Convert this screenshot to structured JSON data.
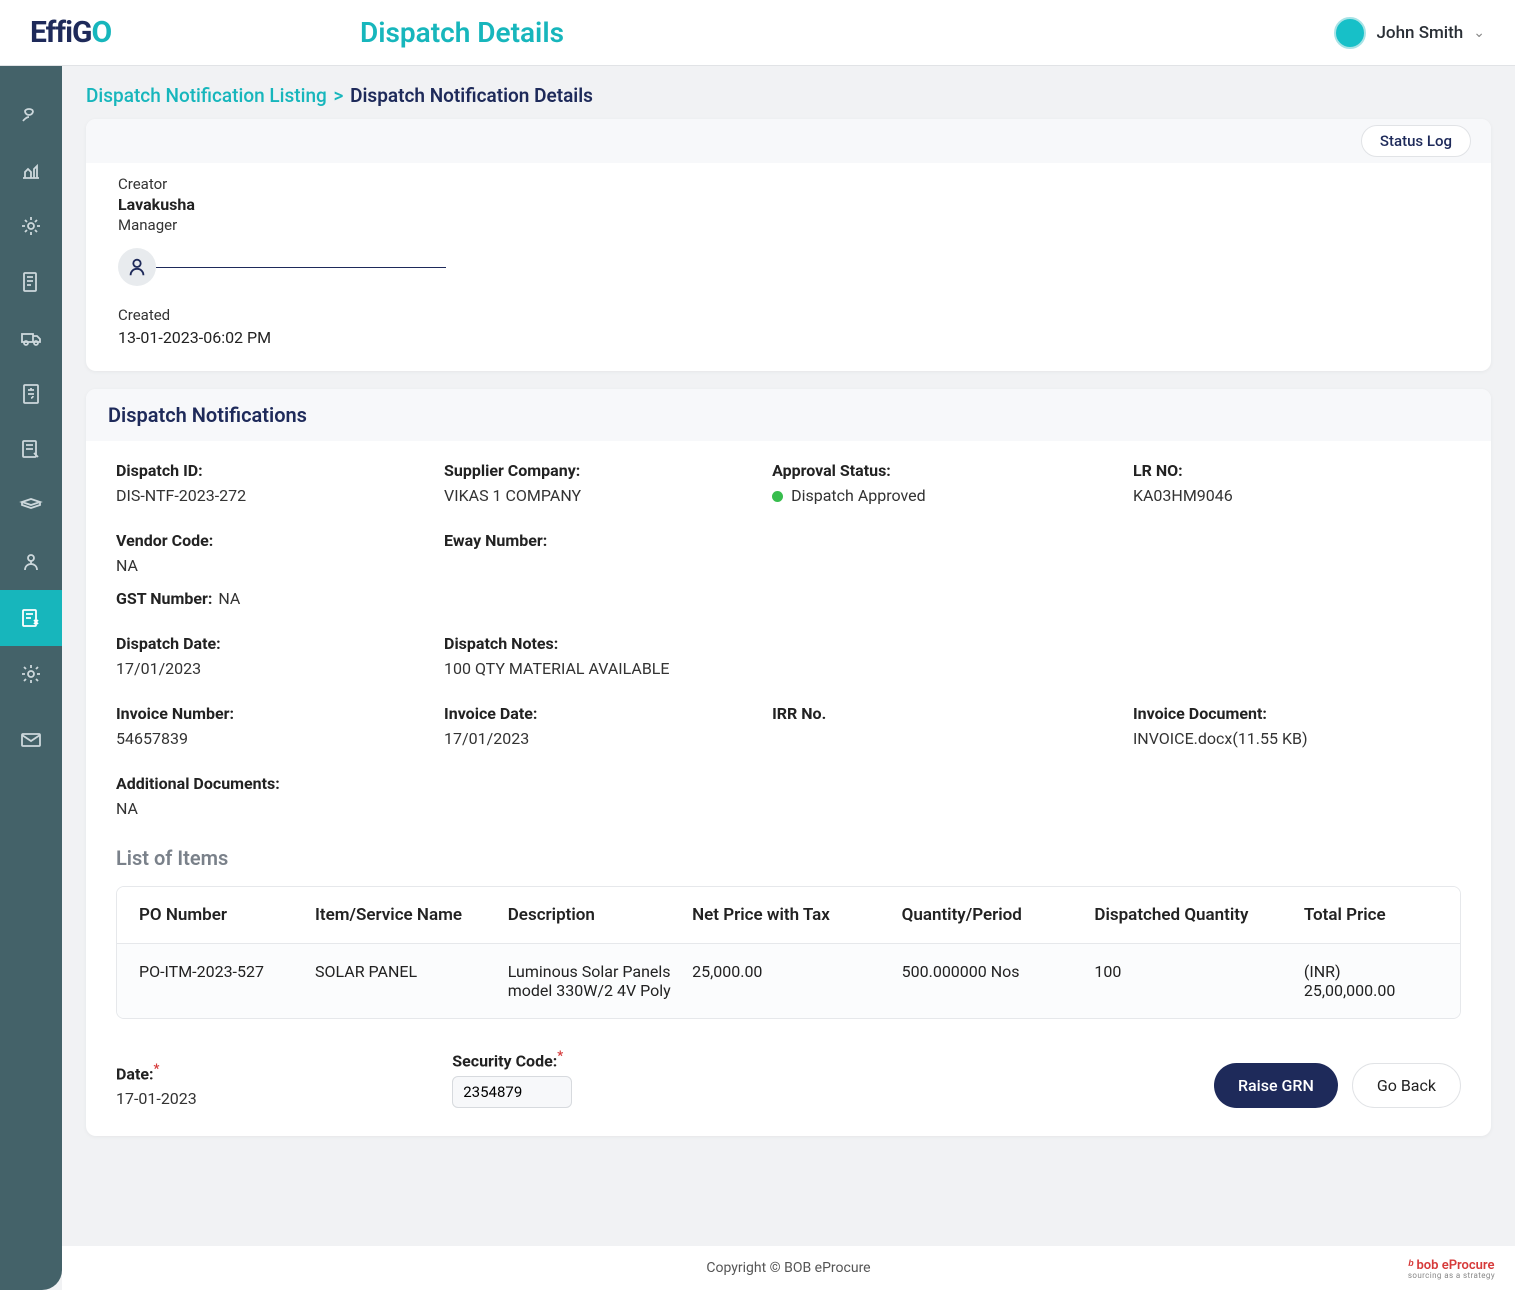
{
  "header": {
    "logo_a": "Effi",
    "logo_b": "G",
    "logo_c": "O",
    "page_title": "Dispatch Details",
    "user_name": "John Smith"
  },
  "breadcrumb": {
    "parent": "Dispatch Notification Listing",
    "sep": ">",
    "current": "Dispatch Notification Details"
  },
  "creator": {
    "status_log_btn": "Status Log",
    "label": "Creator",
    "name": "Lavakusha",
    "role": "Manager",
    "status": "Created",
    "datetime": "13-01-2023-06:02 PM"
  },
  "dispatch": {
    "section_title": "Dispatch Notifications",
    "dispatch_id_label": "Dispatch ID:",
    "dispatch_id": "DIS-NTF-2023-272",
    "supplier_label": "Supplier Company:",
    "supplier": "VIKAS 1 COMPANY",
    "approval_label": "Approval Status:",
    "approval": "Dispatch Approved",
    "lr_label": "LR NO:",
    "lr": "KA03HM9046",
    "vendor_label": "Vendor Code:",
    "vendor": "NA",
    "eway_label": "Eway Number:",
    "eway": "",
    "gst_label": "GST Number:",
    "gst": "NA",
    "date_label": "Dispatch Date:",
    "date": "17/01/2023",
    "notes_label": "Dispatch Notes:",
    "notes": "100 QTY MATERIAL AVAILABLE",
    "inv_no_label": "Invoice Number:",
    "inv_no": "54657839",
    "inv_date_label": "Invoice Date:",
    "inv_date": "17/01/2023",
    "irr_label": "IRR No.",
    "irr": "",
    "inv_doc_label": "Invoice Document:",
    "inv_doc": "INVOICE.docx(11.55 KB)",
    "add_doc_label": "Additional Documents:",
    "add_doc": "NA"
  },
  "items": {
    "title": "List of Items",
    "headers": {
      "po": "PO Number",
      "item": "Item/Service Name",
      "desc": "Description",
      "net": "Net Price with Tax",
      "qty": "Quantity/Period",
      "dispatched": "Dispatched Quantity",
      "total": "Total Price"
    },
    "row": {
      "po": "PO-ITM-2023-527",
      "item": "SOLAR PANEL",
      "desc": "Luminous Solar Panels model 330W/2 4V Poly",
      "net": "25,000.00",
      "qty": "500.000000 Nos",
      "dispatched": "100",
      "total": "(INR) 25,00,000.00"
    }
  },
  "form": {
    "date_label": "Date:",
    "date": "17-01-2023",
    "security_label": "Security Code:",
    "security": "2354879",
    "raise_btn": "Raise GRN",
    "back_btn": "Go Back"
  },
  "footer": {
    "copyright": "Copyright © BOB eProcure",
    "brand": "bob eProcure",
    "tagline": "sourcing as a strategy"
  }
}
